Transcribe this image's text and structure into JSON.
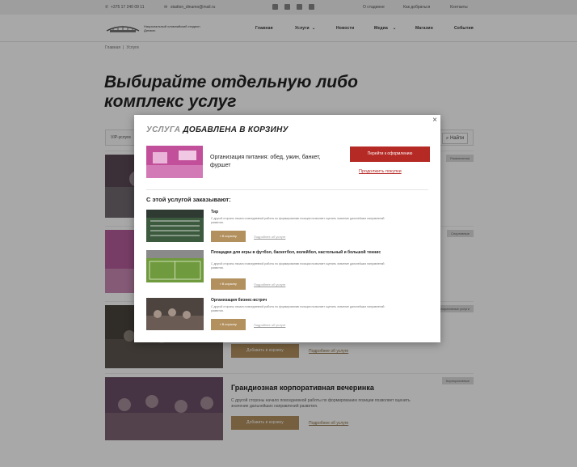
{
  "topbar": {
    "phone": "+375 17 240 09 11",
    "email": "stadion_dinamo@mail.ru",
    "social_icons": [
      "instagram-icon",
      "facebook-icon",
      "vk-icon",
      "odnoklassniki-icon"
    ],
    "links": [
      "О стадионе",
      "Как добраться",
      "Контакты"
    ]
  },
  "header": {
    "logo_text": "Национальный олимпийский стадион Динамо",
    "nav": [
      "Главная",
      "Услуги",
      "Новости",
      "Медиа",
      "Магазин",
      "События"
    ]
  },
  "breadcrumb": {
    "home": "Главная",
    "current": "Услуги"
  },
  "hero": {
    "title": "Выбирайте отдельную либо комплекс услуг"
  },
  "filter": {
    "select_value": "VIP-услуги",
    "search_label": "Найти"
  },
  "cards": [
    {
      "tag": "Развлечения",
      "title": "",
      "desc": ""
    },
    {
      "tag": "Спортивные",
      "title": "",
      "desc": ""
    },
    {
      "tag": "Корпоративные услуги",
      "title": "",
      "desc": "",
      "button": "Добавить в корзину",
      "link": "Подробнее об услуге"
    },
    {
      "tag": "Корпоративные",
      "title": "Грандиозная корпоративная вечеринка",
      "desc": "С другой стороны начало повседневной работы по формированию позиции позволяет оценить значение дальнейших направлений развития.",
      "button": "Добавить в корзину",
      "link": "Подробнее об услуге"
    }
  ],
  "modal": {
    "close": "×",
    "heading_light": "УСЛУГА",
    "heading_dark": "ДОБАВЛЕНА В КОРЗИНУ",
    "added_item": "Организация питания: обед, ужин, банкет, фуршет",
    "checkout_button": "Перейти к оформлению",
    "continue_link": "Продолжить покупки",
    "also_heading": "С этой услугой заказывают:",
    "recommendations": [
      {
        "title": "Тир",
        "desc": "С другой стороны начало повседневной работы по формированию позиции позволяет оценить значение дальнейших направлений развития.",
        "button": "В корзину",
        "link": "Подробнее об услуге"
      },
      {
        "title": "Площадки для игры в футбол, баскетбол, волейбол, настольный и большой теннис",
        "desc": "С другой стороны начало повседневной работы по формированию позиции позволяет оценить значение дальнейших направлений развития.",
        "button": "В корзину",
        "link": "Подробнее об услуге"
      },
      {
        "title": "Организация бизнес-встреч",
        "desc": "С другой стороны начало повседневной работы по формированию позиции позволяет оценить значение дальнейших направлений развития.",
        "button": "В корзину",
        "link": "Подробнее об услуге"
      }
    ]
  },
  "colors": {
    "accent_red": "#b52a25",
    "gold_button": "#b3915f",
    "overlay": "rgba(0,0,0,0.34)"
  }
}
